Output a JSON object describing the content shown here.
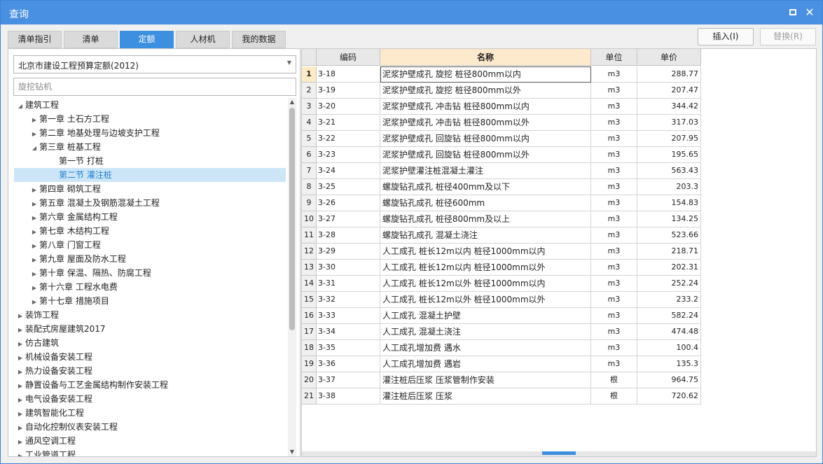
{
  "window": {
    "title": "查询"
  },
  "tabs": [
    "清单指引",
    "清单",
    "定额",
    "人材机",
    "我的数据"
  ],
  "buttons": {
    "insert": "插入(I)",
    "replace": "替换(R)"
  },
  "left": {
    "quota_select": "北京市建设工程预算定额(2012)",
    "search_placeholder": "旋挖钻机",
    "tree": [
      {
        "label": "建筑工程",
        "level": 0,
        "toggle": "expanded"
      },
      {
        "label": "第一章 土石方工程",
        "level": 1,
        "toggle": "collapsed"
      },
      {
        "label": "第二章 地基处理与边坡支护工程",
        "level": 1,
        "toggle": "collapsed"
      },
      {
        "label": "第三章 桩基工程",
        "level": 1,
        "toggle": "expanded"
      },
      {
        "label": "第一节 打桩",
        "level": 2,
        "toggle": "none"
      },
      {
        "label": "第二节 灌注桩",
        "level": 2,
        "toggle": "none",
        "selected": true
      },
      {
        "label": "第四章 砌筑工程",
        "level": 1,
        "toggle": "collapsed"
      },
      {
        "label": "第五章 混凝土及钢筋混凝土工程",
        "level": 1,
        "toggle": "collapsed"
      },
      {
        "label": "第六章 金属结构工程",
        "level": 1,
        "toggle": "collapsed"
      },
      {
        "label": "第七章 木结构工程",
        "level": 1,
        "toggle": "collapsed"
      },
      {
        "label": "第八章 门窗工程",
        "level": 1,
        "toggle": "collapsed"
      },
      {
        "label": "第九章 屋面及防水工程",
        "level": 1,
        "toggle": "collapsed"
      },
      {
        "label": "第十章 保温、隔热、防腐工程",
        "level": 1,
        "toggle": "collapsed"
      },
      {
        "label": "第十六章 工程水电费",
        "level": 1,
        "toggle": "collapsed"
      },
      {
        "label": "第十七章 措施项目",
        "level": 1,
        "toggle": "collapsed"
      },
      {
        "label": "装饰工程",
        "level": 0,
        "toggle": "collapsed"
      },
      {
        "label": "装配式房屋建筑2017",
        "level": 0,
        "toggle": "collapsed"
      },
      {
        "label": "仿古建筑",
        "level": 0,
        "toggle": "collapsed"
      },
      {
        "label": "机械设备安装工程",
        "level": 0,
        "toggle": "collapsed"
      },
      {
        "label": "热力设备安装工程",
        "level": 0,
        "toggle": "collapsed"
      },
      {
        "label": "静置设备与工艺金属结构制作安装工程",
        "level": 0,
        "toggle": "collapsed"
      },
      {
        "label": "电气设备安装工程",
        "level": 0,
        "toggle": "collapsed"
      },
      {
        "label": "建筑智能化工程",
        "level": 0,
        "toggle": "collapsed"
      },
      {
        "label": "自动化控制仪表安装工程",
        "level": 0,
        "toggle": "collapsed"
      },
      {
        "label": "通风空调工程",
        "level": 0,
        "toggle": "collapsed"
      },
      {
        "label": "工业管道工程",
        "level": 0,
        "toggle": "collapsed"
      }
    ]
  },
  "table": {
    "columns": [
      "编码",
      "名称",
      "单位",
      "单价"
    ],
    "rows": [
      {
        "no": "1",
        "code": "3-18",
        "name": "泥浆护壁成孔 旋挖 桩径800mm以内",
        "unit": "m3",
        "price": "288.77"
      },
      {
        "no": "2",
        "code": "3-19",
        "name": "泥浆护壁成孔 旋挖 桩径800mm以外",
        "unit": "m3",
        "price": "207.47"
      },
      {
        "no": "3",
        "code": "3-20",
        "name": "泥浆护壁成孔 冲击钻 桩径800mm以内",
        "unit": "m3",
        "price": "344.42"
      },
      {
        "no": "4",
        "code": "3-21",
        "name": "泥浆护壁成孔 冲击钻 桩径800mm以外",
        "unit": "m3",
        "price": "317.03"
      },
      {
        "no": "5",
        "code": "3-22",
        "name": "泥浆护壁成孔 回旋钻 桩径800mm以内",
        "unit": "m3",
        "price": "207.95"
      },
      {
        "no": "6",
        "code": "3-23",
        "name": "泥浆护壁成孔 回旋钻 桩径800mm以外",
        "unit": "m3",
        "price": "195.65"
      },
      {
        "no": "7",
        "code": "3-24",
        "name": "泥浆护壁灌注桩混凝土灌注",
        "unit": "m3",
        "price": "563.43"
      },
      {
        "no": "8",
        "code": "3-25",
        "name": "螺旋钻孔成孔 桩径400mm及以下",
        "unit": "m3",
        "price": "203.3"
      },
      {
        "no": "9",
        "code": "3-26",
        "name": "螺旋钻孔成孔 桩径600mm",
        "unit": "m3",
        "price": "154.83"
      },
      {
        "no": "10",
        "code": "3-27",
        "name": "螺旋钻孔成孔 桩径800mm及以上",
        "unit": "m3",
        "price": "134.25"
      },
      {
        "no": "11",
        "code": "3-28",
        "name": "螺旋钻孔成孔 混凝土浇注",
        "unit": "m3",
        "price": "523.66"
      },
      {
        "no": "12",
        "code": "3-29",
        "name": "人工成孔 桩长12m以内 桩径1000mm以内",
        "unit": "m3",
        "price": "218.71"
      },
      {
        "no": "13",
        "code": "3-30",
        "name": "人工成孔 桩长12m以内 桩径1000mm以外",
        "unit": "m3",
        "price": "202.31"
      },
      {
        "no": "14",
        "code": "3-31",
        "name": "人工成孔 桩长12m以外 桩径1000mm以内",
        "unit": "m3",
        "price": "252.24"
      },
      {
        "no": "15",
        "code": "3-32",
        "name": "人工成孔 桩长12m以外 桩径1000mm以外",
        "unit": "m3",
        "price": "233.2"
      },
      {
        "no": "16",
        "code": "3-33",
        "name": "人工成孔 混凝土护壁",
        "unit": "m3",
        "price": "582.24"
      },
      {
        "no": "17",
        "code": "3-34",
        "name": "人工成孔 混凝土浇注",
        "unit": "m3",
        "price": "474.48"
      },
      {
        "no": "18",
        "code": "3-35",
        "name": "人工成孔增加费 遇水",
        "unit": "m3",
        "price": "100.4"
      },
      {
        "no": "19",
        "code": "3-36",
        "name": "人工成孔增加费 遇岩",
        "unit": "m3",
        "price": "135.3"
      },
      {
        "no": "20",
        "code": "3-37",
        "name": "灌注桩后压浆 压浆管制作安装",
        "unit": "根",
        "price": "964.75"
      },
      {
        "no": "21",
        "code": "3-38",
        "name": "灌注桩后压浆 压浆",
        "unit": "根",
        "price": "720.62"
      }
    ]
  },
  "colors": {
    "titlebar": "#4a90e2",
    "active_tab": "#3d8fe0",
    "selected_tree": "#cde6f7",
    "name_header": "#fde9cc"
  }
}
